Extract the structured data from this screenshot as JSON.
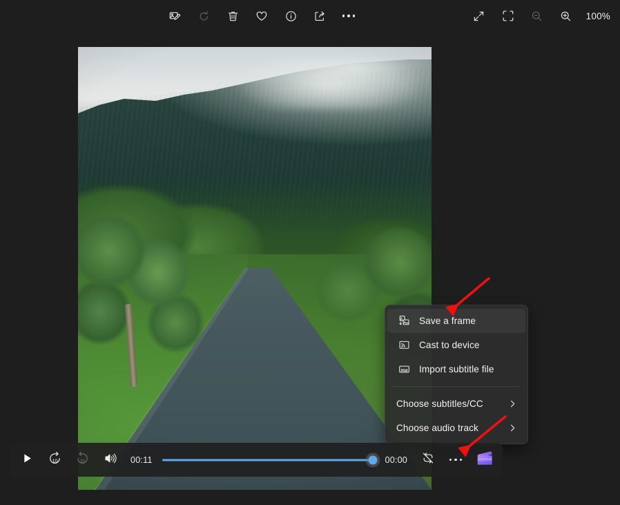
{
  "app": {
    "background_color": "#1e1e1e",
    "accent_color": "#60a9e8"
  },
  "top_toolbar": {
    "items": [
      {
        "name": "edit-image",
        "label": "Edit image",
        "icon": "edit-image-icon",
        "enabled": true
      },
      {
        "name": "rotate",
        "label": "Rotate",
        "icon": "rotate-icon",
        "enabled": false
      },
      {
        "name": "delete",
        "label": "Delete",
        "icon": "trash-icon",
        "enabled": true
      },
      {
        "name": "favorite",
        "label": "Add to favorites",
        "icon": "heart-icon",
        "enabled": true
      },
      {
        "name": "file-info",
        "label": "File info",
        "icon": "info-icon",
        "enabled": true
      },
      {
        "name": "share",
        "label": "Share",
        "icon": "share-icon",
        "enabled": true
      },
      {
        "name": "see-more",
        "label": "See more",
        "icon": "more-horizontal-icon",
        "enabled": true
      }
    ],
    "right_items": [
      {
        "name": "fullscreen",
        "label": "Full screen",
        "icon": "expand-arrows-icon",
        "enabled": true
      },
      {
        "name": "fit-to-window",
        "label": "Fit to window",
        "icon": "fit-to-window-icon",
        "enabled": true
      },
      {
        "name": "zoom-out",
        "label": "Zoom out",
        "icon": "zoom-out-icon",
        "enabled": false
      },
      {
        "name": "zoom-in",
        "label": "Zoom in",
        "icon": "zoom-in-icon",
        "enabled": true
      }
    ],
    "zoom_level": "100%"
  },
  "context_menu": {
    "items": [
      {
        "label": "Save a frame",
        "icon": "save-frame-icon",
        "has_submenu": false,
        "highlighted": true
      },
      {
        "label": "Cast to device",
        "icon": "cast-icon",
        "has_submenu": false,
        "highlighted": false
      },
      {
        "label": "Import subtitle file",
        "icon": "subtitle-icon",
        "has_submenu": false,
        "highlighted": false
      }
    ],
    "submenu_items": [
      {
        "label": "Choose subtitles/CC",
        "icon": null,
        "has_submenu": true,
        "highlighted": false
      },
      {
        "label": "Choose audio track",
        "icon": null,
        "has_submenu": true,
        "highlighted": false
      }
    ]
  },
  "player": {
    "play_label": "Play",
    "rewind_label": "Rewind 10 seconds",
    "rewind_seconds": "10",
    "forward_label": "Forward 30 seconds",
    "forward_seconds": "30",
    "volume_label": "Volume",
    "elapsed_time": "00:11",
    "remaining_time": "00:00",
    "progress_percent": 99,
    "repeat_label": "Repeat off",
    "more_options_label": "More options",
    "clipchamp_label": "Edit in Clipchamp"
  },
  "annotations": [
    {
      "name": "arrow-to-save-a-frame",
      "color": "#ee1111",
      "points_at": "Save a frame"
    },
    {
      "name": "arrow-to-player-more-options",
      "color": "#ee1111",
      "points_at": "More options"
    }
  ]
}
